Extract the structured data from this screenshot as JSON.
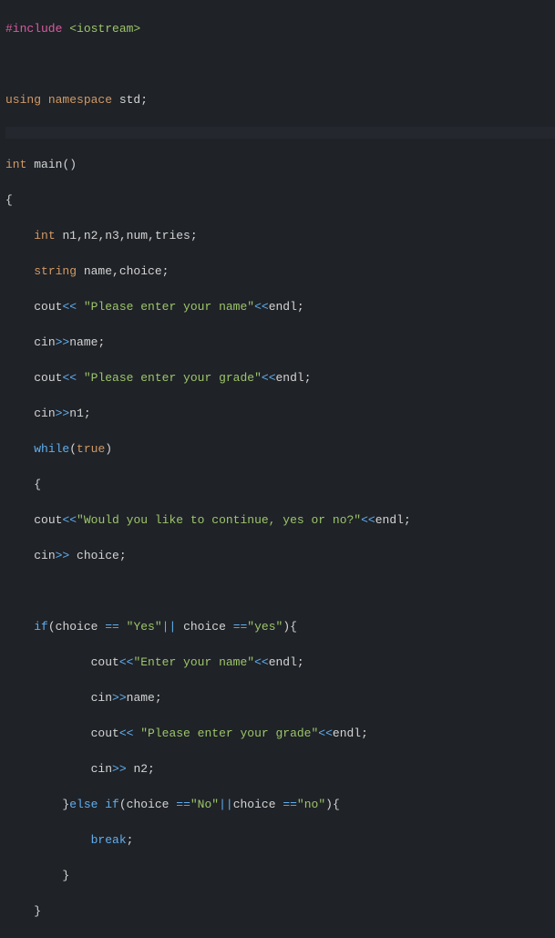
{
  "code": {
    "l1_preproc": "#include ",
    "l1_header": "<iostream>",
    "l3_using": "using ",
    "l3_namespace": "namespace ",
    "l3_std": "std",
    "l3_semi": ";",
    "l5_type": "int ",
    "l5_func": "main",
    "l5_paren": "()",
    "l6_brace": "{",
    "l7_indent": "    ",
    "l7_type": "int ",
    "l7_vars": "n1,n2,n3,num,tries;",
    "l8_indent": "    ",
    "l8_type": "string ",
    "l8_vars": "name,choice;",
    "l9_indent": "    ",
    "l9_cout": "cout",
    "l9_op1": "<< ",
    "l9_str": "\"Please enter your name\"",
    "l9_op2": "<<",
    "l9_endl": "endl",
    "l9_semi": ";",
    "l10_indent": "    ",
    "l10_cin": "cin",
    "l10_op": ">>",
    "l10_var": "name",
    "l10_semi": ";",
    "l11_indent": "    ",
    "l11_cout": "cout",
    "l11_op1": "<< ",
    "l11_str": "\"Please enter your grade\"",
    "l11_op2": "<<",
    "l11_endl": "endl",
    "l11_semi": ";",
    "l12_indent": "    ",
    "l12_cin": "cin",
    "l12_op": ">>",
    "l12_var": "n1",
    "l12_semi": ";",
    "l13_indent": "    ",
    "l13_while": "while",
    "l13_paren1": "(",
    "l13_true": "true",
    "l13_paren2": ")",
    "l14_indent": "    ",
    "l14_brace": "{",
    "l15_indent": "    ",
    "l15_cout": "cout",
    "l15_op1": "<<",
    "l15_str": "\"Would you like to continue, yes or no?\"",
    "l15_op2": "<<",
    "l15_endl": "endl",
    "l15_semi": ";",
    "l16_indent": "    ",
    "l16_cin": "cin",
    "l16_op": ">> ",
    "l16_var": "choice",
    "l16_semi": ";",
    "l18_indent": "    ",
    "l18_if": "if",
    "l18_p1": "(",
    "l18_v1": "choice ",
    "l18_eq1": "== ",
    "l18_s1": "\"Yes\"",
    "l18_or": "|| ",
    "l18_v2": "choice ",
    "l18_eq2": "==",
    "l18_s2": "\"yes\"",
    "l18_p2": "){",
    "l19_indent": "            ",
    "l19_cout": "cout",
    "l19_op1": "<<",
    "l19_str": "\"Enter your name\"",
    "l19_op2": "<<",
    "l19_endl": "endl",
    "l19_semi": ";",
    "l20_indent": "            ",
    "l20_cin": "cin",
    "l20_op": ">>",
    "l20_var": "name",
    "l20_semi": ";",
    "l21_indent": "            ",
    "l21_cout": "cout",
    "l21_op1": "<< ",
    "l21_str": "\"Please enter your grade\"",
    "l21_op2": "<<",
    "l21_endl": "endl",
    "l21_semi": ";",
    "l22_indent": "            ",
    "l22_cin": "cin",
    "l22_op": ">> ",
    "l22_var": "n2",
    "l22_semi": ";",
    "l23_indent": "        ",
    "l23_brace": "}",
    "l23_else": "else if",
    "l23_p1": "(",
    "l23_v1": "choice ",
    "l23_eq1": "==",
    "l23_s1": "\"No\"",
    "l23_or": "||",
    "l23_v2": "choice ",
    "l23_eq2": "==",
    "l23_s2": "\"no\"",
    "l23_p2": "){",
    "l24_indent": "            ",
    "l24_break": "break",
    "l24_semi": ";",
    "l25_indent": "        ",
    "l25_brace": "}",
    "l26_indent": "    ",
    "l26_brace": "}"
  }
}
